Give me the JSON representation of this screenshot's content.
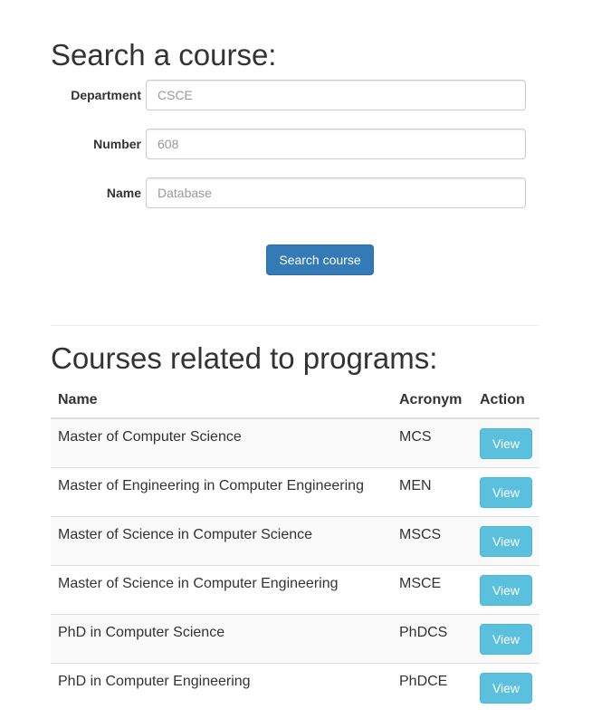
{
  "search": {
    "title": "Search a course:",
    "fields": [
      {
        "label": "Department",
        "placeholder": "CSCE",
        "value": ""
      },
      {
        "label": "Number",
        "placeholder": "608",
        "value": ""
      },
      {
        "label": "Name",
        "placeholder": "Database",
        "value": ""
      }
    ],
    "submit_label": "Search course"
  },
  "programs": {
    "title": "Courses related to programs:",
    "columns": [
      "Name",
      "Acronym",
      "Action"
    ],
    "rows": [
      {
        "name": "Master of Computer Science",
        "acronym": "MCS",
        "action": "View"
      },
      {
        "name": "Master of Engineering in Computer Engineering",
        "acronym": "MEN",
        "action": "View"
      },
      {
        "name": "Master of Science in Computer Science",
        "acronym": "MSCS",
        "action": "View"
      },
      {
        "name": "Master of Science in Computer Engineering",
        "acronym": "MSCE",
        "action": "View"
      },
      {
        "name": "PhD in Computer Science",
        "acronym": "PhDCS",
        "action": "View"
      },
      {
        "name": "PhD in Computer Engineering",
        "acronym": "PhDCE",
        "action": "View"
      }
    ]
  },
  "colors": {
    "primary": "#337ab7",
    "info": "#5bc0de",
    "text": "#333333",
    "stripe": "#f9f9f9",
    "border": "#dddddd"
  }
}
